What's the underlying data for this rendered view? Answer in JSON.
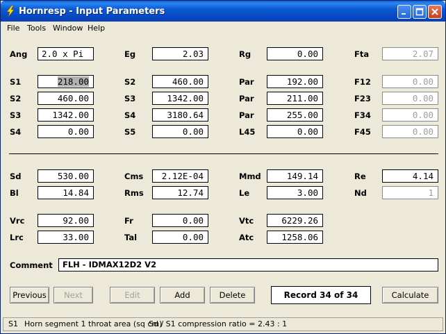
{
  "window": {
    "title": "Hornresp - Input Parameters"
  },
  "menu": [
    "File",
    "Tools",
    "Window",
    "Help"
  ],
  "params": {
    "Ang": "2.0 x Pi",
    "Eg": "2.03",
    "Rg": "0.00",
    "Fta": "2.07",
    "S1a": "218.00",
    "S2b": "460.00",
    "Par1": "192.00",
    "F12": "0.00",
    "S2a": "460.00",
    "S3b": "1342.00",
    "Par2": "211.00",
    "F23": "0.00",
    "S3a": "1342.00",
    "S4b": "3180.64",
    "Par3": "255.00",
    "F34": "0.00",
    "S4a": "0.00",
    "S5b": "0.00",
    "L45": "0.00",
    "F45": "0.00",
    "Sd": "530.00",
    "Cms": "2.12E-04",
    "Mmd": "149.14",
    "Re": "4.14",
    "Bl": "14.84",
    "Rms": "12.74",
    "Le": "3.00",
    "Nd": "1",
    "Vrc": "92.00",
    "Fr": "0.00",
    "Vtc": "6229.26",
    "Lrc": "33.00",
    "Tal": "0.00",
    "Atc": "1258.06"
  },
  "labels": {
    "Ang": "Ang",
    "Eg": "Eg",
    "Rg": "Rg",
    "Fta": "Fta",
    "S1": "S1",
    "S2": "S2",
    "S3": "S3",
    "S4": "S4",
    "S5": "S5",
    "Par": "Par",
    "L45": "L45",
    "F12": "F12",
    "F23": "F23",
    "F34": "F34",
    "F45": "F45",
    "Sd": "Sd",
    "Cms": "Cms",
    "Mmd": "Mmd",
    "Re": "Re",
    "Bl": "Bl",
    "Rms": "Rms",
    "Le": "Le",
    "Nd": "Nd",
    "Vrc": "Vrc",
    "Fr": "Fr",
    "Vtc": "Vtc",
    "Lrc": "Lrc",
    "Tal": "Tal",
    "Atc": "Atc",
    "Comment": "Comment"
  },
  "comment": "FLH - IDMAX12D2 V2",
  "buttons": {
    "previous": "Previous",
    "next": "Next",
    "edit": "Edit",
    "add": "Add",
    "delete": "Delete",
    "calculate": "Calculate"
  },
  "record": "Record 34 of 34",
  "status": {
    "field": "S1",
    "description": "Horn segment 1 throat area  (sq cm)",
    "ratio": "Sd / S1 compression ratio = 2.43 : 1"
  }
}
